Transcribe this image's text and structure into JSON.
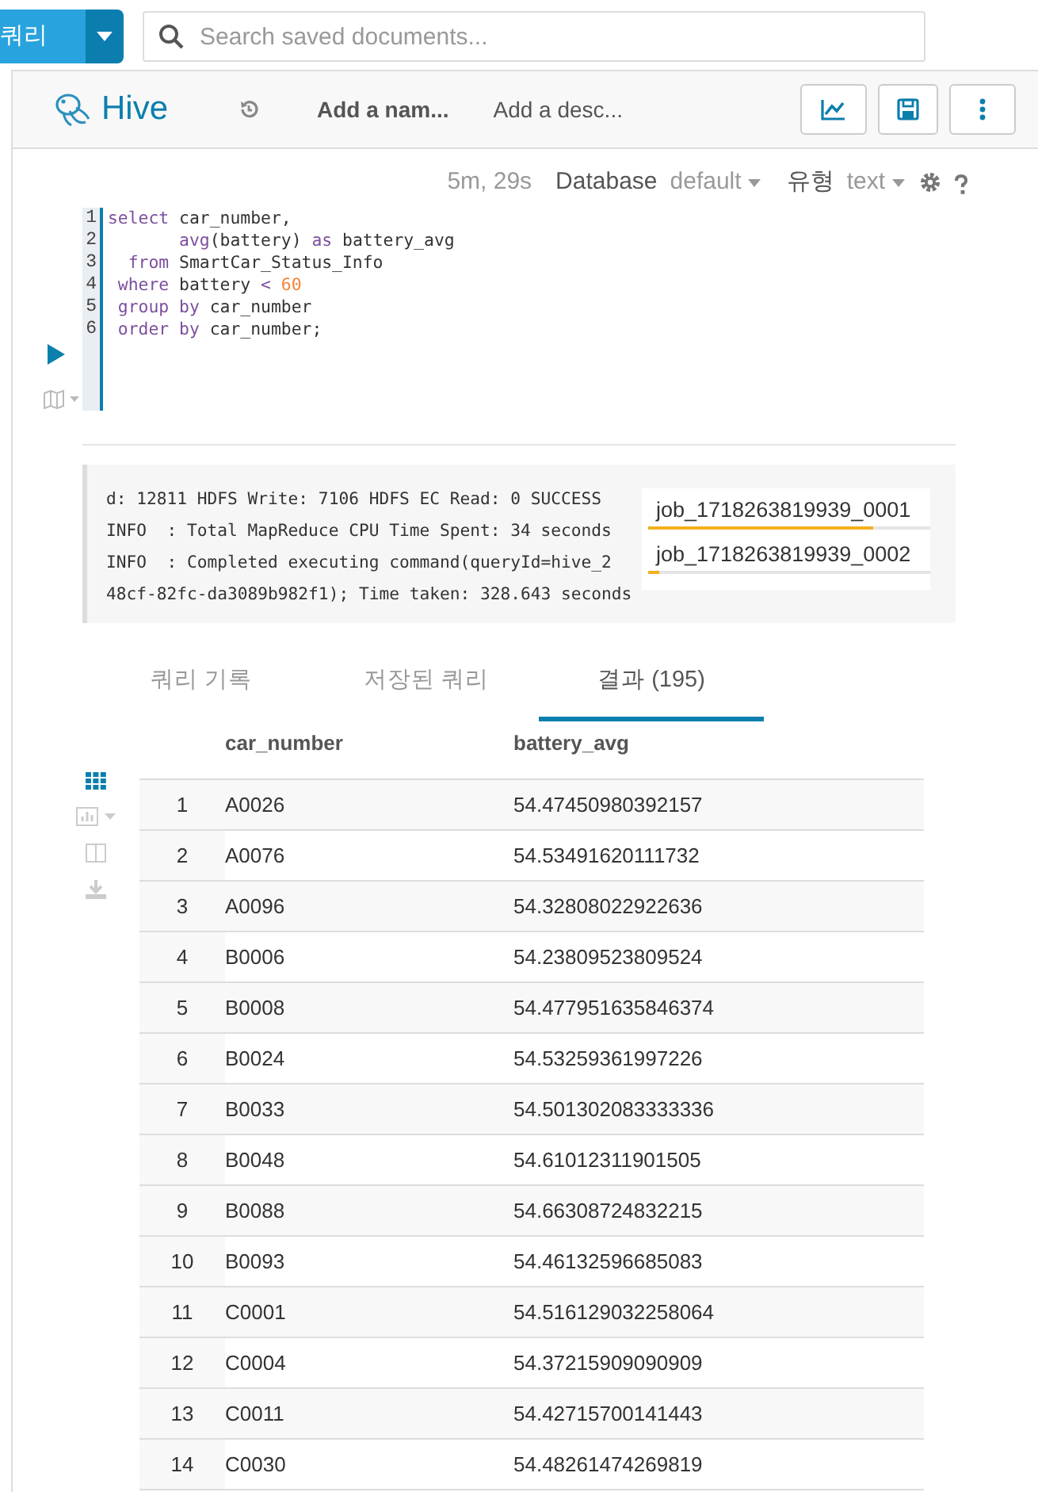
{
  "topbar": {
    "new_button": "쿼리",
    "search": {
      "placeholder": "Search saved documents..."
    }
  },
  "header": {
    "app": "Hive",
    "name": "Add a nam...",
    "description": "Add a desc..."
  },
  "toolbar": {
    "duration": "5m, 29s",
    "database_label": "Database",
    "database": "default",
    "type_label": "유형",
    "type": "text"
  },
  "editor": {
    "lines": [
      {
        "number": "1",
        "tokens": [
          {
            "kind": "keyword",
            "text": "select"
          },
          {
            "kind": "plain",
            "text": " car_number,"
          }
        ]
      },
      {
        "number": "2",
        "tokens": [
          {
            "kind": "keyword",
            "text": "       avg"
          },
          {
            "kind": "plain",
            "text": "(battery) "
          },
          {
            "kind": "keyword",
            "text": "as"
          },
          {
            "kind": "plain",
            "text": " battery_avg"
          }
        ]
      },
      {
        "number": "3",
        "tokens": [
          {
            "kind": "keyword",
            "text": "  from"
          },
          {
            "kind": "plain",
            "text": " SmartCar_Status_Info"
          }
        ]
      },
      {
        "number": "4",
        "tokens": [
          {
            "kind": "keyword",
            "text": " where"
          },
          {
            "kind": "plain",
            "text": " battery "
          },
          {
            "kind": "keyword",
            "text": "<"
          },
          {
            "kind": "number",
            "text": " 60"
          }
        ]
      },
      {
        "number": "5",
        "tokens": [
          {
            "kind": "keyword",
            "text": " group"
          },
          {
            "kind": "keyword",
            "text": " by"
          },
          {
            "kind": "plain",
            "text": " car_number"
          }
        ]
      },
      {
        "number": "6",
        "tokens": [
          {
            "kind": "keyword",
            "text": " order"
          },
          {
            "kind": "keyword",
            "text": " by"
          },
          {
            "kind": "plain",
            "text": " car_number;"
          }
        ]
      }
    ]
  },
  "log": {
    "lines": [
      "d: 12811 HDFS Write: 7106 HDFS EC Read: 0 SUCCESS",
      "INFO  : Total MapReduce CPU Time Spent: 34 seconds",
      "INFO  : Completed executing command(queryId=hive_2",
      "48cf-82fc-da3089b982f1); Time taken: 328.643 seconds"
    ],
    "jobs": [
      {
        "label": "job_1718263819939_0001",
        "level": 0.8
      },
      {
        "label": "job_1718263819939_0002",
        "level": 0.04
      }
    ]
  },
  "tabs": [
    {
      "label": "쿼리 기록",
      "selected": false
    },
    {
      "label": "저장된 쿼리",
      "selected": false
    },
    {
      "label": "결과 (195)",
      "selected": true
    }
  ],
  "results": {
    "columns": [
      "",
      "car_number",
      "battery_avg"
    ],
    "rows": [
      [
        "1",
        "A0026",
        "54.47450980392157"
      ],
      [
        "2",
        "A0076",
        "54.53491620111732"
      ],
      [
        "3",
        "A0096",
        "54.32808022922636"
      ],
      [
        "4",
        "B0006",
        "54.23809523809524"
      ],
      [
        "5",
        "B0008",
        "54.477951635846374"
      ],
      [
        "6",
        "B0024",
        "54.53259361997226"
      ],
      [
        "7",
        "B0033",
        "54.501302083333336"
      ],
      [
        "8",
        "B0048",
        "54.61012311901505"
      ],
      [
        "9",
        "B0088",
        "54.66308724832215"
      ],
      [
        "10",
        "B0093",
        "54.46132596685083"
      ],
      [
        "11",
        "C0001",
        "54.516129032258064"
      ],
      [
        "12",
        "C0004",
        "54.37215909090909"
      ],
      [
        "13",
        "C0011",
        "54.42715700141443"
      ],
      [
        "14",
        "C0030",
        "54.48261474269819"
      ]
    ]
  }
}
